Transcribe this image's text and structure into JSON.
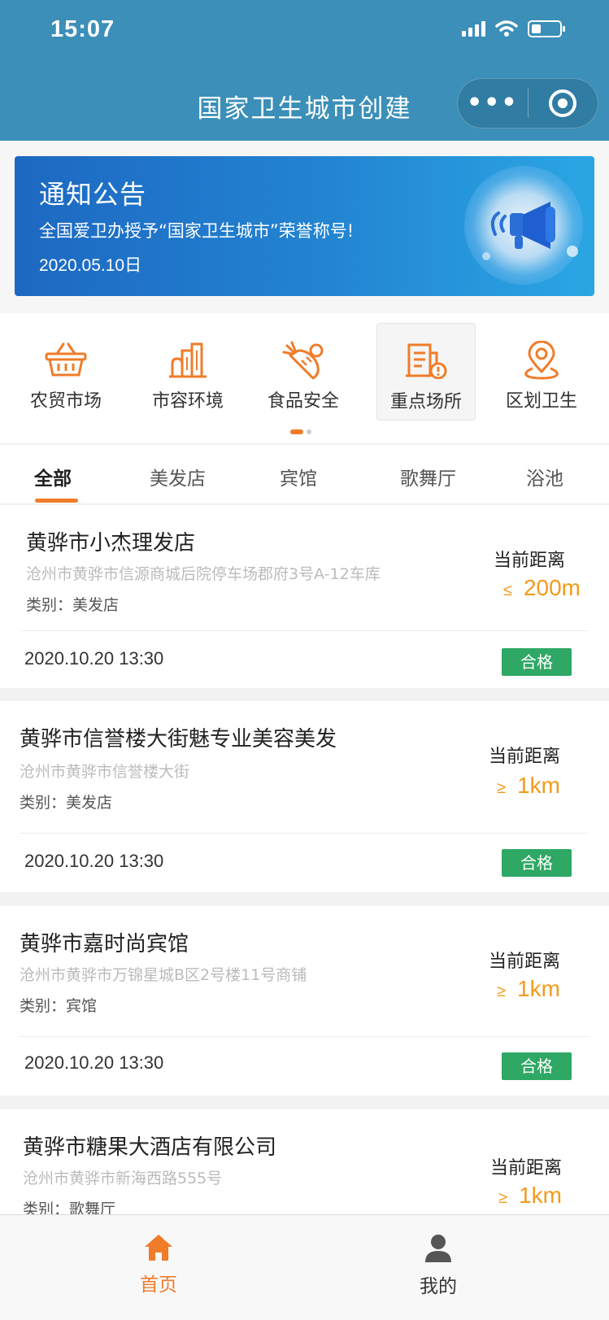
{
  "status_bar": {
    "time": "15:07"
  },
  "nav": {
    "title": "国家卫生城市创建",
    "more": "•••"
  },
  "banner": {
    "title": "通知公告",
    "message": "全国爱卫办授予“国家卫生城市”荣誉称号!",
    "date": "2020.05.10日"
  },
  "categories": [
    {
      "label": "农贸市场",
      "icon": "basket-icon"
    },
    {
      "label": "市容环境",
      "icon": "buildings-icon"
    },
    {
      "label": "食品安全",
      "icon": "vegetables-icon"
    },
    {
      "label": "重点场所",
      "icon": "building-alert-icon",
      "active": true
    },
    {
      "label": "区划卫生",
      "icon": "location-pin-icon"
    }
  ],
  "tabs": [
    "全部",
    "美发店",
    "宾馆",
    "歌舞厅",
    "浴池"
  ],
  "active_tab": "全部",
  "distance_label": "当前距离",
  "listings": [
    {
      "name": "黄骅市小杰理发店",
      "address": "沧州市黄骅市信源商城后院停车场郡府3号A-12车库",
      "category": "类别：美发店",
      "distance_op": "≤",
      "distance": "200m",
      "time": "2020.10.20 13:30",
      "status": "合格"
    },
    {
      "name": "黄骅市信誉楼大街魅专业美容美发",
      "address": "沧州市黄骅市信誉楼大街",
      "category": "类别：美发店",
      "distance_op": "≥",
      "distance": "1km",
      "time": "2020.10.20 13:30",
      "status": "合格"
    },
    {
      "name": "黄骅市嘉时尚宾馆",
      "address": "沧州市黄骅市万锦星城B区2号楼11号商铺",
      "category": "类别：宾馆",
      "distance_op": "≥",
      "distance": "1km",
      "time": "2020.10.20 13:30",
      "status": "合格"
    },
    {
      "name": "黄骅市糖果大酒店有限公司",
      "address": "沧州市黄骅市新海西路555号",
      "category": "类别：歌舞厅",
      "distance_op": "≥",
      "distance": "1km"
    }
  ],
  "tabbar": {
    "home": "首页",
    "mine": "我的"
  },
  "colors": {
    "header": "#3b8fb8",
    "accent": "#f07c2a",
    "distance": "#f39a1c",
    "pass_badge": "#2ea864"
  }
}
